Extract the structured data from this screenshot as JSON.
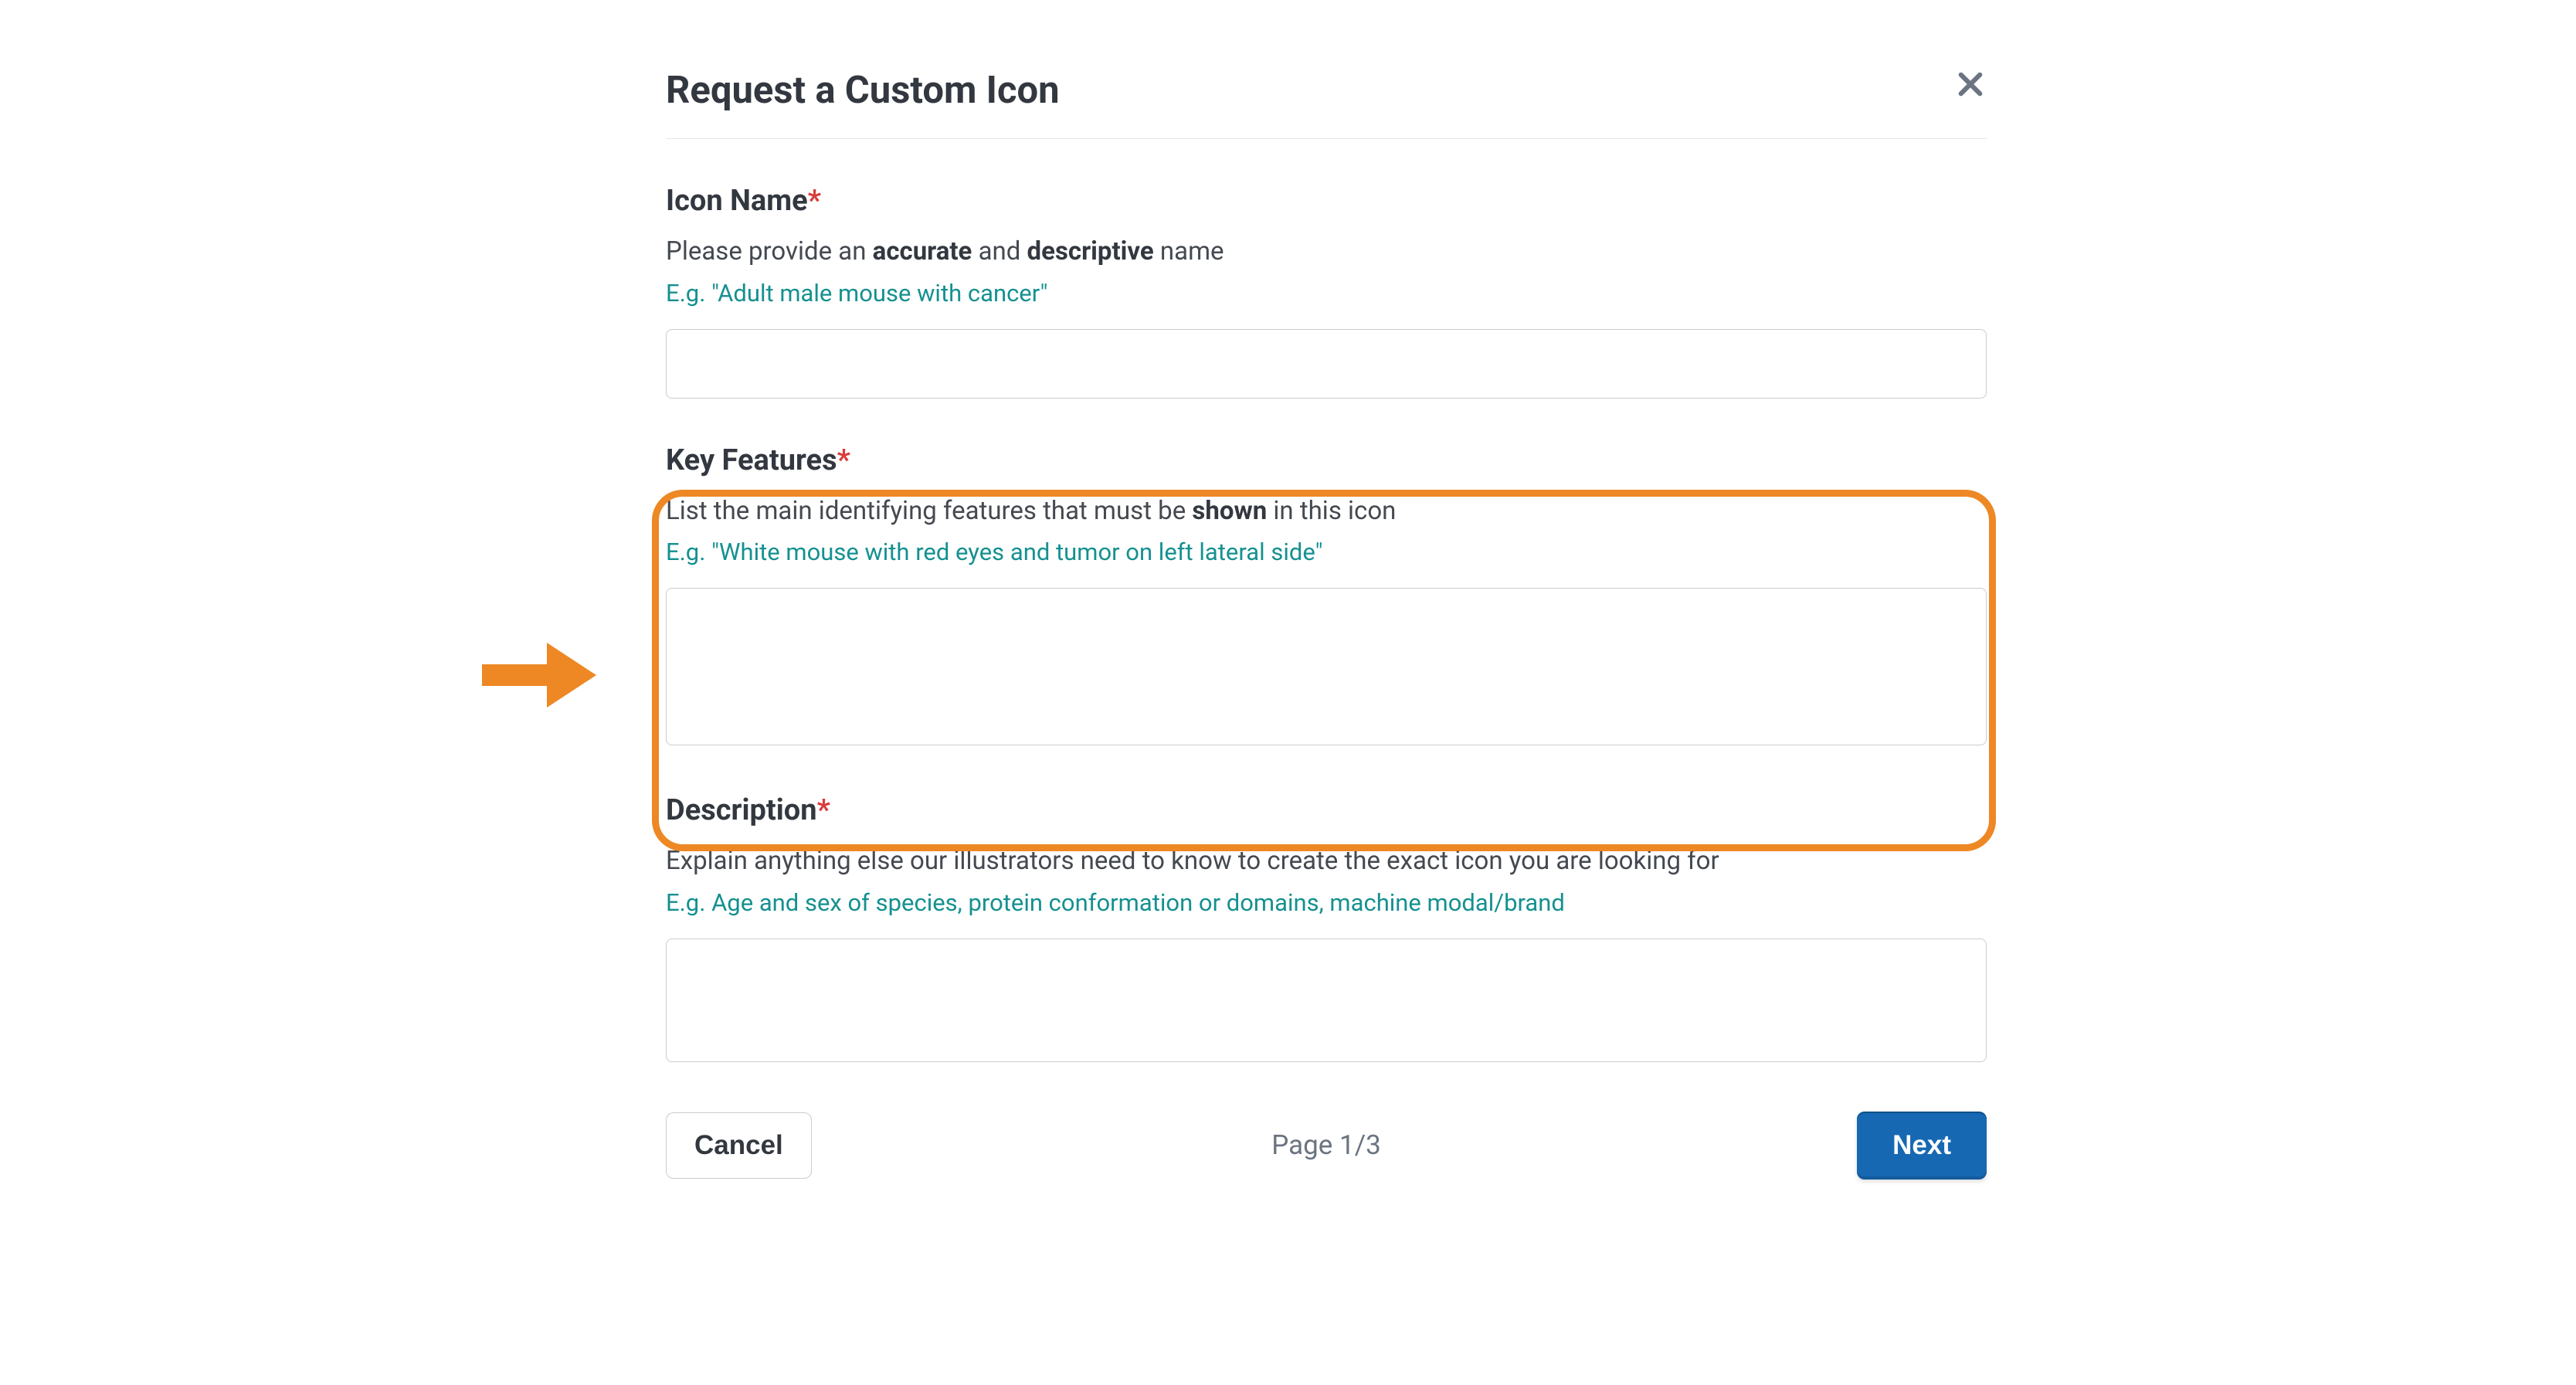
{
  "modal": {
    "title": "Request a Custom Icon"
  },
  "iconName": {
    "label": "Icon Name",
    "required": "*",
    "help_prefix": "Please provide an ",
    "help_b1": "accurate",
    "help_mid": " and ",
    "help_b2": "descriptive",
    "help_suffix": " name",
    "example": "E.g. \"Adult male mouse with cancer\"",
    "value": ""
  },
  "keyFeatures": {
    "label": "Key Features",
    "required": "*",
    "help_prefix": "List the main identifying features that must be ",
    "help_b1": "shown",
    "help_suffix": " in this icon",
    "example": "E.g. \"White mouse with red eyes and tumor on left lateral side\"",
    "value": ""
  },
  "description": {
    "label": "Description",
    "required": "*",
    "help": "Explain anything else our illustrators need to know to create the exact icon you are looking for",
    "example": "E.g. Age and sex of species, protein conformation or domains, machine modal/brand",
    "value": ""
  },
  "footer": {
    "cancel": "Cancel",
    "page": "Page 1/3",
    "next": "Next"
  }
}
